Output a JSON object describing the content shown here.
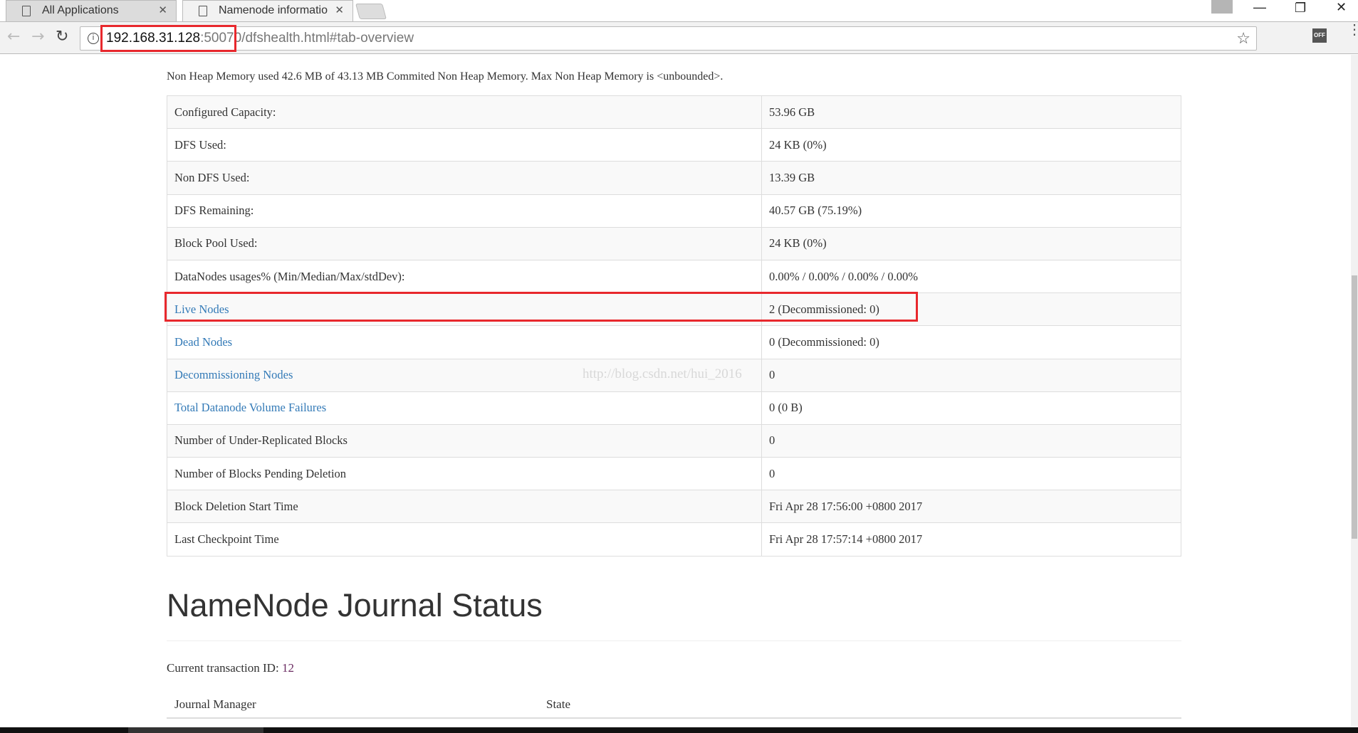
{
  "browser": {
    "tabs": [
      {
        "label": "All Applications"
      },
      {
        "label": "Namenode informatio"
      }
    ],
    "url": {
      "host": "192.168.31.128",
      "port": ":50070",
      "path": "/dfshealth.html#tab-overview"
    },
    "extension_label": "OFF"
  },
  "page": {
    "non_heap_note": "Non Heap Memory used 42.6 MB of 43.13 MB Commited Non Heap Memory. Max Non Heap Memory is <unbounded>.",
    "summary_rows": [
      {
        "key": "Configured Capacity:",
        "value": "53.96 GB"
      },
      {
        "key": "DFS Used:",
        "value": "24 KB (0%)"
      },
      {
        "key": "Non DFS Used:",
        "value": "13.39 GB"
      },
      {
        "key": "DFS Remaining:",
        "value": "40.57 GB (75.19%)"
      },
      {
        "key": "Block Pool Used:",
        "value": "24 KB (0%)"
      },
      {
        "key": "DataNodes usages% (Min/Median/Max/stdDev):",
        "value": "0.00% / 0.00% / 0.00% / 0.00%"
      },
      {
        "key": "Live Nodes",
        "value": "2 (Decommissioned: 0)"
      },
      {
        "key": "Dead Nodes",
        "value": "0 (Decommissioned: 0)"
      },
      {
        "key": "Decommissioning Nodes",
        "value": "0"
      },
      {
        "key": "Total Datanode Volume Failures",
        "value": "0 (0 B)"
      },
      {
        "key": "Number of Under-Replicated Blocks",
        "value": "0"
      },
      {
        "key": "Number of Blocks Pending Deletion",
        "value": "0"
      },
      {
        "key": "Block Deletion Start Time",
        "value": "Fri Apr 28 17:56:00 +0800 2017"
      },
      {
        "key": "Last Checkpoint Time",
        "value": "Fri Apr 28 17:57:14 +0800 2017"
      }
    ],
    "watermark": "http://blog.csdn.net/hui_2016",
    "journal": {
      "title": "NameNode Journal Status",
      "txid_label": "Current transaction ID:",
      "txid_value": "12",
      "columns": [
        "Journal Manager",
        "State"
      ]
    }
  }
}
